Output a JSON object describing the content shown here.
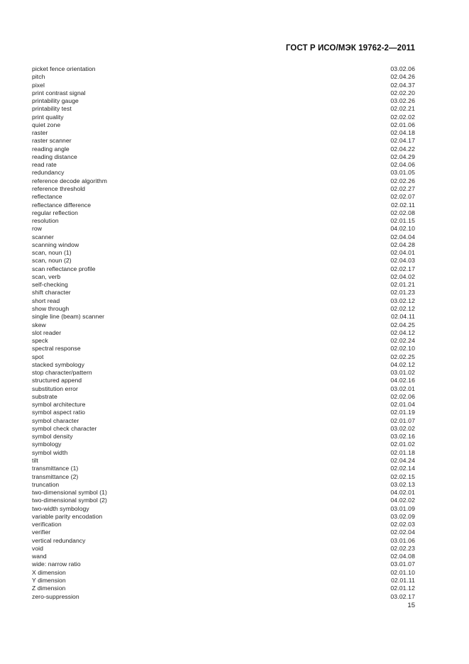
{
  "document": {
    "header": "ГОСТ Р ИСО/МЭК 19762-2—2011",
    "page_number": "15"
  },
  "index": {
    "entries": [
      {
        "term": "picket fence orientation",
        "ref": "03.02.06"
      },
      {
        "term": "pitch",
        "ref": "02.04.26"
      },
      {
        "term": "pixel",
        "ref": "02.04.37"
      },
      {
        "term": "print contrast signal",
        "ref": "02.02.20"
      },
      {
        "term": "printability gauge",
        "ref": "03.02.26"
      },
      {
        "term": "printability test",
        "ref": "02.02.21"
      },
      {
        "term": "print quality",
        "ref": "02.02.02"
      },
      {
        "term": "quiet zone",
        "ref": "02.01.06"
      },
      {
        "term": "raster",
        "ref": "02.04.18"
      },
      {
        "term": "raster scanner",
        "ref": "02.04.17"
      },
      {
        "term": "reading angle",
        "ref": "02.04.22"
      },
      {
        "term": "reading distance",
        "ref": "02.04.29"
      },
      {
        "term": "read rate",
        "ref": "02.04.06"
      },
      {
        "term": "redundancy",
        "ref": "03.01.05"
      },
      {
        "term": "reference decode algorithm",
        "ref": "02.02.26"
      },
      {
        "term": "reference threshold",
        "ref": "02.02.27"
      },
      {
        "term": "reflectance",
        "ref": "02.02.07"
      },
      {
        "term": "reflectance difference",
        "ref": "02.02.11"
      },
      {
        "term": "regular reflection",
        "ref": "02.02.08"
      },
      {
        "term": "resolution",
        "ref": "02.01.15"
      },
      {
        "term": "row",
        "ref": "04.02.10"
      },
      {
        "term": "scanner",
        "ref": "02.04.04"
      },
      {
        "term": "scanning window",
        "ref": "02.04.28"
      },
      {
        "term": "scan, noun (1)",
        "ref": "02.04.01"
      },
      {
        "term": "scan, noun (2)",
        "ref": "02.04.03"
      },
      {
        "term": "scan reflectance profile",
        "ref": "02.02.17"
      },
      {
        "term": "scan, verb",
        "ref": "02.04.02"
      },
      {
        "term": "self-checking",
        "ref": "02.01.21"
      },
      {
        "term": "shift character",
        "ref": "02.01.23"
      },
      {
        "term": "short read",
        "ref": "03.02.12"
      },
      {
        "term": "show through",
        "ref": "02.02.12"
      },
      {
        "term": "single line (beam) scanner",
        "ref": "02.04.11"
      },
      {
        "term": "skew",
        "ref": "02.04.25"
      },
      {
        "term": "slot reader",
        "ref": "02.04.12"
      },
      {
        "term": "speck",
        "ref": "02.02.24"
      },
      {
        "term": "spectral response",
        "ref": "02.02.10"
      },
      {
        "term": "spot",
        "ref": "02.02.25"
      },
      {
        "term": "stacked symbology",
        "ref": "04.02.12"
      },
      {
        "term": "stop character/pattern",
        "ref": "03.01.02"
      },
      {
        "term": "structured append",
        "ref": "04.02.16"
      },
      {
        "term": "substitution error",
        "ref": "03.02.01"
      },
      {
        "term": "substrate",
        "ref": "02.02.06"
      },
      {
        "term": "symbol architecture",
        "ref": "02.01.04"
      },
      {
        "term": "symbol aspect ratio",
        "ref": "02.01.19"
      },
      {
        "term": "symbol character",
        "ref": "02.01.07"
      },
      {
        "term": "symbol check character",
        "ref": "03.02.02"
      },
      {
        "term": "symbol density",
        "ref": "03.02.16"
      },
      {
        "term": "symbology",
        "ref": "02.01.02"
      },
      {
        "term": "symbol width",
        "ref": "02.01.18"
      },
      {
        "term": "tilt",
        "ref": "02.04.24"
      },
      {
        "term": "transmittance (1)",
        "ref": "02.02.14"
      },
      {
        "term": "transmittance (2)",
        "ref": "02.02.15"
      },
      {
        "term": "truncation",
        "ref": "03.02.13"
      },
      {
        "term": "two-dimensional symbol (1)",
        "ref": "04.02.01"
      },
      {
        "term": "two-dimensional symbol (2)",
        "ref": "04.02.02"
      },
      {
        "term": "two-width symbology",
        "ref": "03.01.09"
      },
      {
        "term": "variable parity encodation",
        "ref": "03.02.09"
      },
      {
        "term": "verification",
        "ref": "02.02.03"
      },
      {
        "term": "verifier",
        "ref": "02.02.04"
      },
      {
        "term": "vertical redundancy",
        "ref": "03.01.06"
      },
      {
        "term": "void",
        "ref": "02.02.23"
      },
      {
        "term": "wand",
        "ref": "02.04.08"
      },
      {
        "term": "wide: narrow ratio",
        "ref": "03.01.07"
      },
      {
        "term": "X dimension",
        "ref": "02.01.10"
      },
      {
        "term": "Y dimension",
        "ref": "02.01.11"
      },
      {
        "term": "Z dimension",
        "ref": "02.01.12"
      },
      {
        "term": "zero-suppression",
        "ref": "03.02.17"
      }
    ]
  }
}
